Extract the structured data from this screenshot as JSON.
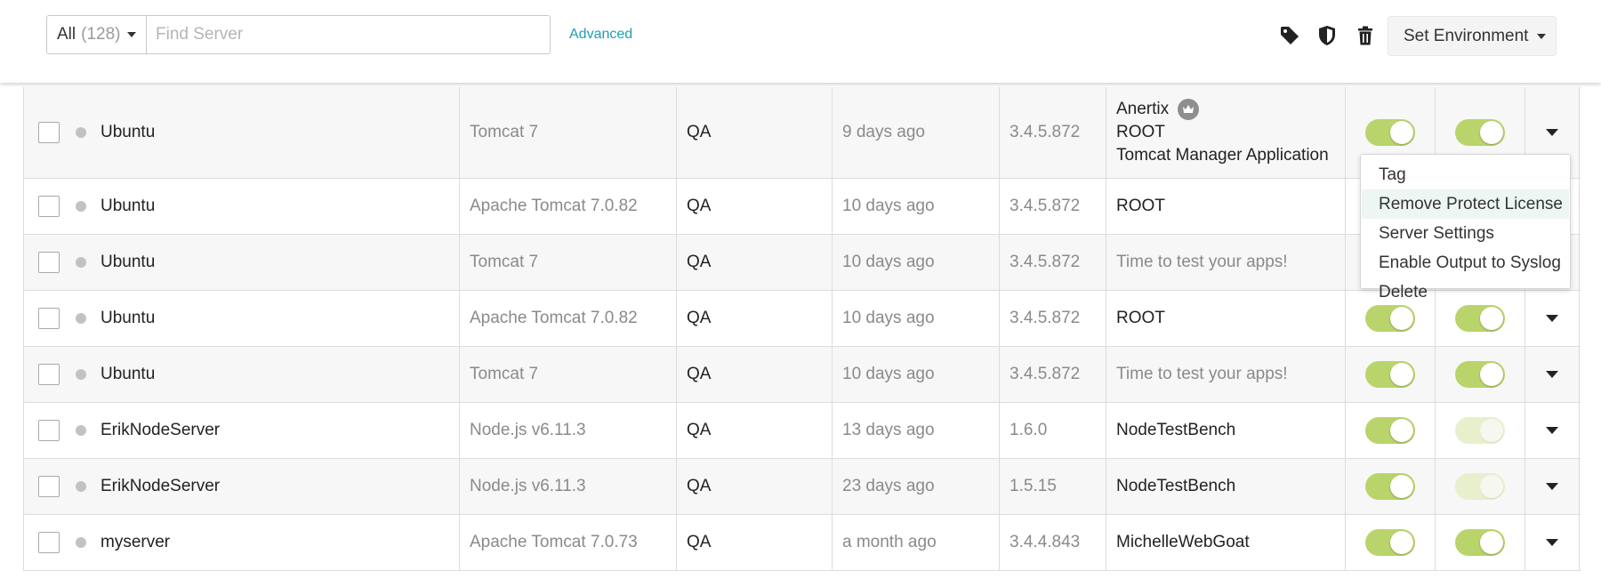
{
  "toolbar": {
    "filter_label": "All",
    "filter_count": "(128)",
    "search_placeholder": "Find Server",
    "advanced_label": "Advanced",
    "icons": [
      "tag-icon",
      "shield-icon",
      "trash-icon"
    ],
    "set_environment_label": "Set Environment"
  },
  "colors": {
    "accent_link": "#1e9eb1",
    "toggle_on": "#b9d46a",
    "toggle_faded": "#e7efcd",
    "status_dot": "#c2c2c2"
  },
  "servers": [
    {
      "name": "Ubuntu",
      "app_server": "Tomcat 7",
      "environment": "QA",
      "last_seen": "9 days ago",
      "agent_version": "3.4.5.872",
      "apps": [
        "Anertix",
        "ROOT",
        "Tomcat Manager Application"
      ],
      "toggle1": "on",
      "toggle2": "on"
    },
    {
      "name": "Ubuntu",
      "app_server": "Apache Tomcat 7.0.82",
      "environment": "QA",
      "last_seen": "10 days ago",
      "agent_version": "3.4.5.872",
      "apps": [
        "ROOT"
      ],
      "toggle1": "hidden",
      "toggle2": "hidden"
    },
    {
      "name": "Ubuntu",
      "app_server": "Tomcat 7",
      "environment": "QA",
      "last_seen": "10 days ago",
      "agent_version": "3.4.5.872",
      "apps": [
        "Time to test your apps!"
      ],
      "toggle1": "hidden",
      "toggle2": "hidden"
    },
    {
      "name": "Ubuntu",
      "app_server": "Apache Tomcat 7.0.82",
      "environment": "QA",
      "last_seen": "10 days ago",
      "agent_version": "3.4.5.872",
      "apps": [
        "ROOT"
      ],
      "toggle1": "on",
      "toggle2": "on"
    },
    {
      "name": "Ubuntu",
      "app_server": "Tomcat 7",
      "environment": "QA",
      "last_seen": "10 days ago",
      "agent_version": "3.4.5.872",
      "apps": [
        "Time to test your apps!"
      ],
      "toggle1": "on",
      "toggle2": "on"
    },
    {
      "name": "ErikNodeServer",
      "app_server": "Node.js v6.11.3",
      "environment": "QA",
      "last_seen": "13 days ago",
      "agent_version": "1.6.0",
      "apps": [
        "NodeTestBench"
      ],
      "toggle1": "on",
      "toggle2": "faded"
    },
    {
      "name": "ErikNodeServer",
      "app_server": "Node.js v6.11.3",
      "environment": "QA",
      "last_seen": "23 days ago",
      "agent_version": "1.5.15",
      "apps": [
        "NodeTestBench"
      ],
      "toggle1": "on",
      "toggle2": "faded"
    },
    {
      "name": "myserver",
      "app_server": "Apache Tomcat 7.0.73",
      "environment": "QA",
      "last_seen": "a month ago",
      "agent_version": "3.4.4.843",
      "apps": [
        "MichelleWebGoat"
      ],
      "toggle1": "on",
      "toggle2": "on"
    }
  ],
  "menu": {
    "items": [
      "Tag",
      "Remove Protect License",
      "Server Settings",
      "Enable Output to Syslog",
      "Delete"
    ],
    "highlighted_index": 1
  }
}
